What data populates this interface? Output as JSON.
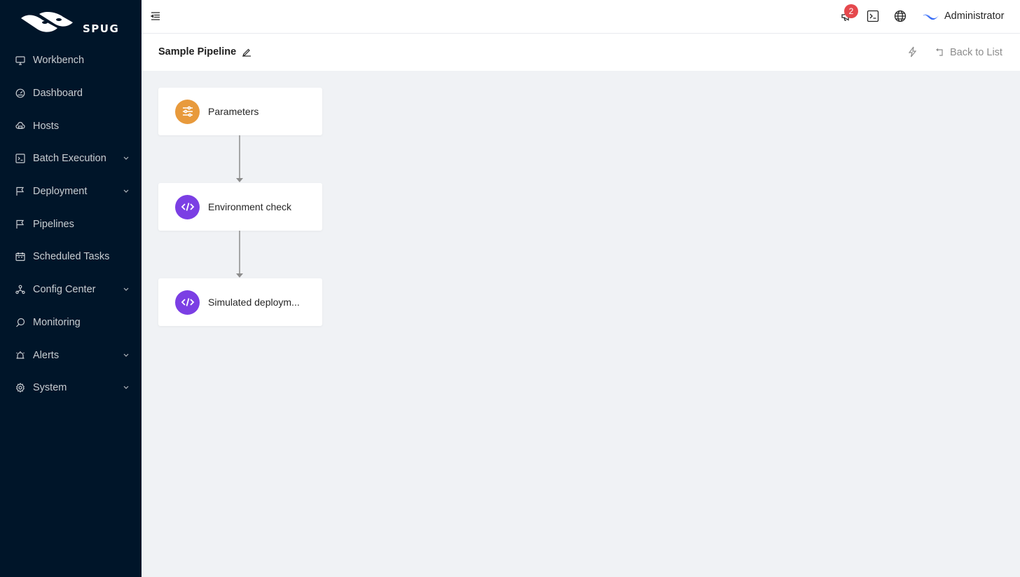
{
  "brand": {
    "logo_text": "SPUG"
  },
  "sidebar": {
    "items": [
      {
        "label": "Workbench",
        "icon": "desktop-icon",
        "has_submenu": false
      },
      {
        "label": "Dashboard",
        "icon": "dashboard-icon",
        "has_submenu": false
      },
      {
        "label": "Hosts",
        "icon": "cloud-server-icon",
        "has_submenu": false
      },
      {
        "label": "Batch Execution",
        "icon": "code-icon",
        "has_submenu": true
      },
      {
        "label": "Deployment",
        "icon": "flag-icon",
        "has_submenu": true
      },
      {
        "label": "Pipelines",
        "icon": "flag-icon",
        "has_submenu": false
      },
      {
        "label": "Scheduled Tasks",
        "icon": "calendar-icon",
        "has_submenu": false
      },
      {
        "label": "Config Center",
        "icon": "deployment-unit-icon",
        "has_submenu": true
      },
      {
        "label": "Monitoring",
        "icon": "monitor-icon",
        "has_submenu": false
      },
      {
        "label": "Alerts",
        "icon": "alert-icon",
        "has_submenu": true
      },
      {
        "label": "System",
        "icon": "setting-icon",
        "has_submenu": true
      }
    ]
  },
  "header": {
    "notification_count": "2",
    "username": "Administrator"
  },
  "page": {
    "title": "Sample Pipeline",
    "back_label": "Back to List"
  },
  "pipeline": {
    "nodes": [
      {
        "label": "Parameters",
        "icon": "sliders-icon",
        "color": "#e89a3c"
      },
      {
        "label": "Environment check",
        "icon": "code-tag-icon",
        "color": "#7b3fe4"
      },
      {
        "label": "Simulated deploym...",
        "icon": "code-tag-icon",
        "color": "#7b3fe4"
      }
    ]
  },
  "colors": {
    "sidebar_bg": "#001529",
    "canvas_bg": "#f0f2f5",
    "badge": "#e5484d",
    "connector": "#8c8c8c"
  }
}
